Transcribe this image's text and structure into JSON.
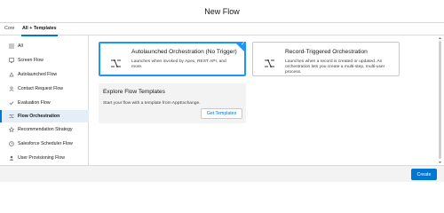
{
  "header": {
    "title": "New Flow"
  },
  "tabs": [
    {
      "label": "Core",
      "active": false
    },
    {
      "label": "All + Templates",
      "active": true
    }
  ],
  "sidebar": {
    "items": [
      {
        "label": "All",
        "icon": "all-icon",
        "active": false
      },
      {
        "label": "Screen Flow",
        "icon": "screen-icon",
        "active": false
      },
      {
        "label": "Autolaunched Flow",
        "icon": "autolaunch-icon",
        "active": false
      },
      {
        "label": "Contact Request Flow",
        "icon": "contact-request-icon",
        "active": false
      },
      {
        "label": "Evaluation Flow",
        "icon": "evaluation-icon",
        "active": false
      },
      {
        "label": "Flow Orchestration",
        "icon": "orchestration-icon",
        "active": true
      },
      {
        "label": "Recommendation Strategy",
        "icon": "recommendation-icon",
        "active": false
      },
      {
        "label": "Salesforce Scheduler Flow",
        "icon": "scheduler-icon",
        "active": false
      },
      {
        "label": "User Provisioning Flow",
        "icon": "user-provisioning-icon",
        "active": false
      }
    ]
  },
  "cards": [
    {
      "title": "Autolaunched Orchestration (No Trigger)",
      "description": "Launches when invoked by Apex, REST API, and more.",
      "icon": "orchestration-icon",
      "selected": true
    },
    {
      "title": "Record-Triggered Orchestration",
      "description": "Launches when a record is created or updated. An orchestration lets you create a multi-step, multi-user process.",
      "icon": "orchestration-icon",
      "selected": false
    }
  ],
  "explore": {
    "title": "Explore Flow Templates",
    "description": "Start your flow with a template from AppExchange.",
    "button_label": "Get Templates"
  },
  "footer": {
    "create_label": "Create"
  },
  "colors": {
    "accent": "#0176d3",
    "selected_border": "#1b96ff",
    "active_bg": "#e4eef9"
  }
}
